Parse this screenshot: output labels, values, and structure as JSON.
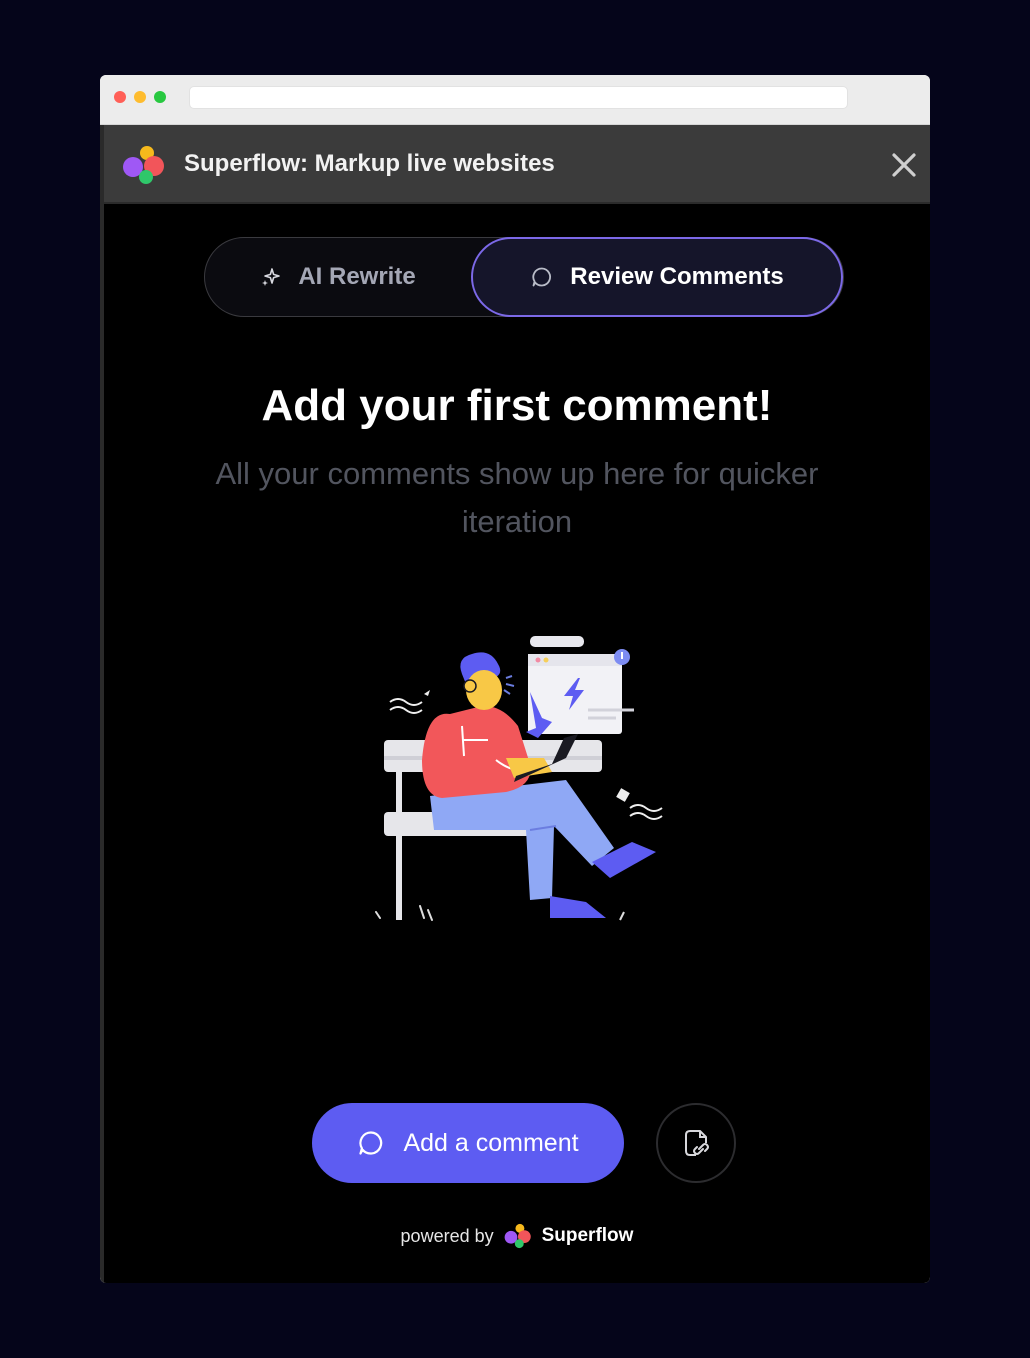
{
  "window": {
    "url": ""
  },
  "panel": {
    "title": "Superflow: Markup live websites",
    "close_icon": "close-icon"
  },
  "tabs": [
    {
      "label": "AI Rewrite",
      "icon": "sparkle-icon",
      "active": false
    },
    {
      "label": "Review Comments",
      "icon": "comment-bubble-icon",
      "active": true
    }
  ],
  "empty_state": {
    "headline": "Add your first comment!",
    "subtext": "All your comments show up here for quicker iteration"
  },
  "actions": {
    "add_comment_label": "Add a comment",
    "add_comment_icon": "comment-bubble-icon",
    "share_link_icon": "file-link-icon"
  },
  "footer": {
    "powered_by": "powered by",
    "brand": "Superflow"
  },
  "colors": {
    "accent": "#5d5cf2",
    "active_tab_border": "#7c69e8",
    "panel_bg": "#000000",
    "header_bg": "#3b3b3b"
  }
}
